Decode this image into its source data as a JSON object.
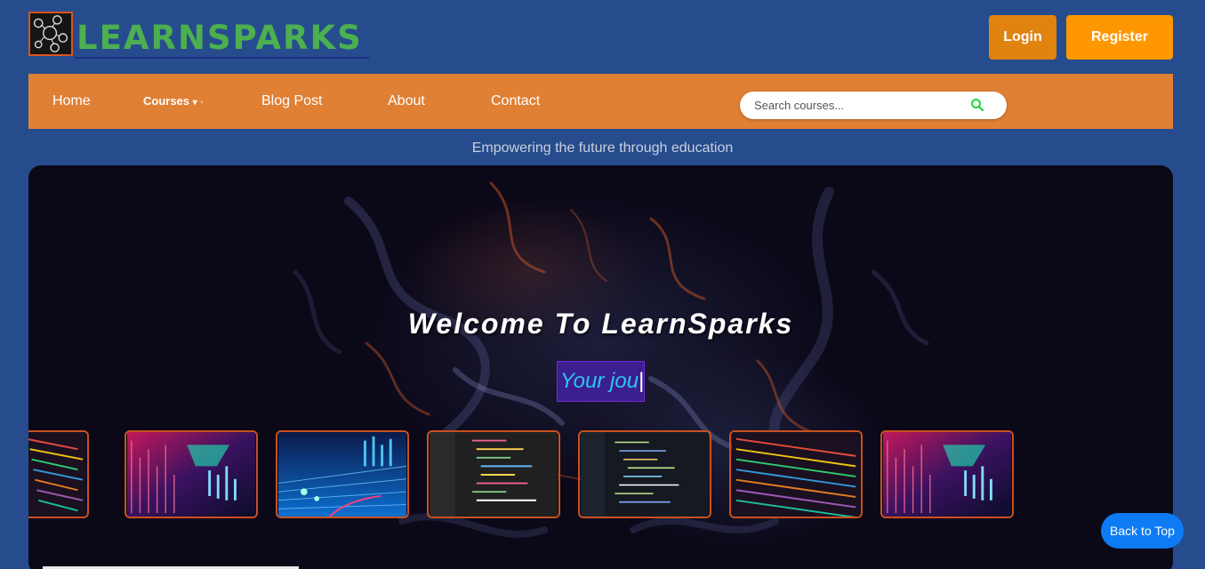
{
  "header": {
    "brand": "LEARNSPARKS",
    "login_label": "Login",
    "register_label": "Register",
    "logo_icon": "logo-icon"
  },
  "nav": {
    "items": [
      {
        "label": "Home"
      },
      {
        "label": "Courses"
      },
      {
        "label": "Blog Post"
      },
      {
        "label": "About"
      },
      {
        "label": "Contact"
      }
    ],
    "courses_caret": "▾",
    "search": {
      "placeholder": "Search courses...",
      "icon": "search-icon"
    }
  },
  "tagline": "Empowering the future through education",
  "hero": {
    "title": "Welcome To LearnSparks",
    "typed_text": "Your jou",
    "cursor": "|",
    "thumbnails": [
      {
        "name": "code-lines"
      },
      {
        "name": "abstract-data"
      },
      {
        "name": "digital-road"
      },
      {
        "name": "code-editor"
      },
      {
        "name": "dark-ide"
      },
      {
        "name": "code-lines"
      },
      {
        "name": "abstract-data"
      }
    ]
  },
  "back_to_top_label": "Back to Top",
  "colors": {
    "page_bg": "#264c8e",
    "nav_bg": "#e08035",
    "login_bg": "#e0830f",
    "register_bg": "#ff9800",
    "brand": "#4caf50",
    "back_to_top_bg": "#0d7bf3",
    "typed_text": "#2dc4f2"
  }
}
